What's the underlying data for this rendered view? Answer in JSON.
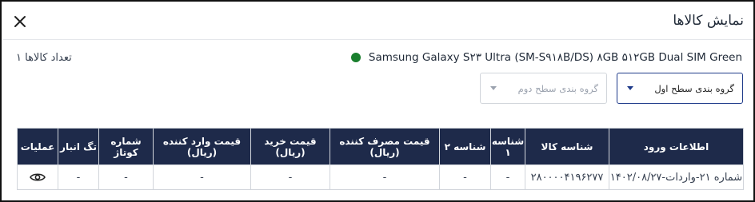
{
  "dialog": {
    "title": "نمایش کالاها",
    "product_name": "Samsung Galaxy S۲۳ Ultra (SM-S۹۱۸B/DS) ۸GB ۵۱۲GB Dual SIM Green",
    "status_color": "#1a7f2e",
    "item_count": "تعداد کالاها ۱",
    "close_icon": "close-icon"
  },
  "filters": {
    "level1_label": "گروه بندی سطح اول",
    "level2_placeholder": "گروه بندی سطح دوم"
  },
  "table": {
    "headers": [
      "اطلاعات ورود",
      "شناسه کالا",
      "شناسه ۱",
      "شناسه ۲",
      "قیمت مصرف کننده (ریال)",
      "قیمت خرید (ریال)",
      "قیمت وارد کننده (ریال)",
      "شماره کوتاژ",
      "تگ انبار",
      "عملیات"
    ],
    "rows": [
      {
        "entry_info": "شماره ۲۱-واردات-۱۴۰۲/۰۸/۲۷",
        "product_id": "۲۸۰۰۰۰۴۱۹۶۲۷۷",
        "id1": "-",
        "id2": "-",
        "consumer_price": "-",
        "purchase_price": "-",
        "importer_price": "-",
        "cottage_no": "-",
        "warehouse_tag": "-",
        "action_icon": "eye-icon"
      }
    ]
  },
  "colors": {
    "header_bg": "#1e2a4a",
    "accent": "#1e3a8a"
  }
}
